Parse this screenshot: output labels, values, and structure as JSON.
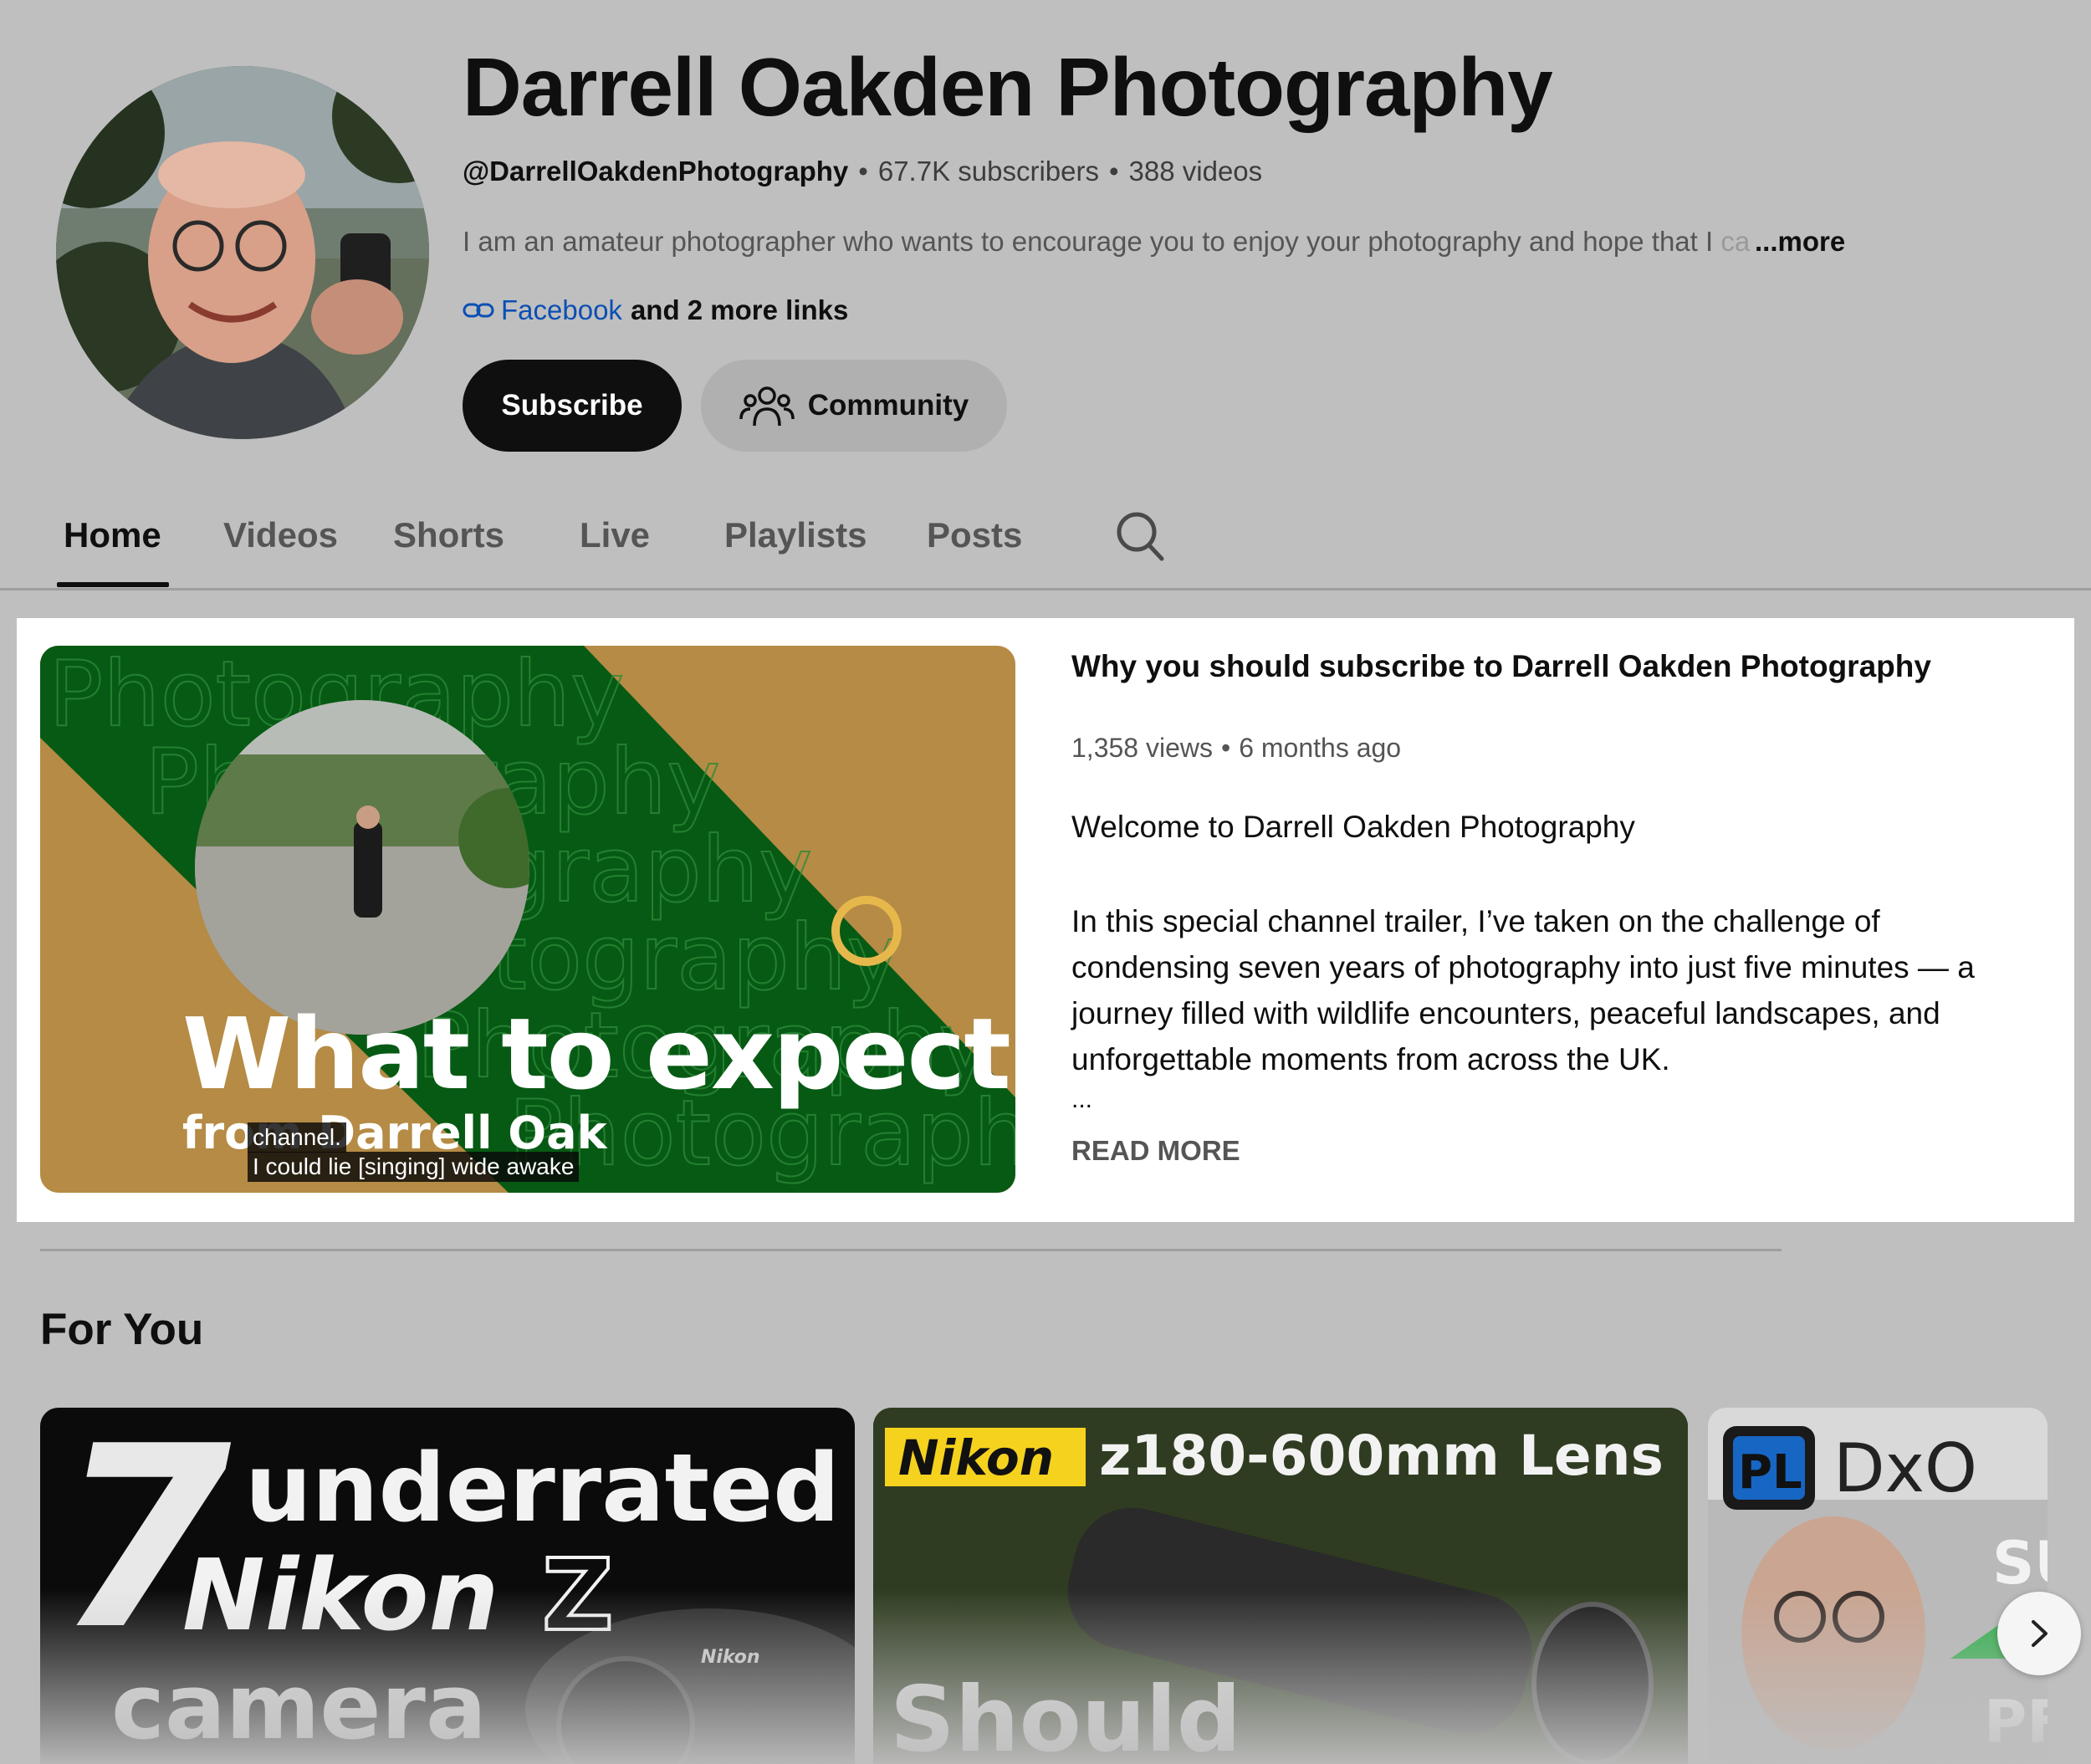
{
  "channel": {
    "title": "Darrell Oakden Photography",
    "handle": "@DarrellOakdenPhotography",
    "subscribers": "67.7K subscribers",
    "videos": "388 videos",
    "separator": "•",
    "description": "I am an amateur photographer who wants to encourage you to enjoy your photography and hope that I ",
    "description_fade": "ca",
    "more_label": "...more",
    "link_primary": "Facebook",
    "link_rest": "and 2 more links"
  },
  "actions": {
    "subscribe_label": "Subscribe",
    "community_label": "Community"
  },
  "tabs": [
    {
      "label": "Home",
      "active": true
    },
    {
      "label": "Videos"
    },
    {
      "label": "Shorts"
    },
    {
      "label": "Live"
    },
    {
      "label": "Playlists"
    },
    {
      "label": "Posts"
    }
  ],
  "featured": {
    "title": "Why you should subscribe to Darrell Oakden Photography",
    "views": "1,358 views",
    "age": "6 months ago",
    "separator": "•",
    "welcome": "Welcome to Darrell Oakden Photography",
    "description": "In this special channel trailer, I’ve taken on the challenge of condensing seven years of photography into just five minutes — a journey filled with wildlife encounters, peaceful landscapes, and unforgettable moments from across the UK.",
    "ellipsis": "...",
    "read_more": "READ MORE",
    "thumbnail": {
      "watermark": "Photography",
      "headline": "What to expect",
      "subline": "from Darrell Oak",
      "caption_1": "channel.",
      "caption_2": "I could lie [singing] wide awake",
      "colors": {
        "green": "#075a14",
        "gold": "#b58b45",
        "ring": "#e6b84c"
      }
    }
  },
  "for_you": {
    "title": "For You",
    "videos": [
      {
        "thumb_text": [
          "7",
          "underrated",
          "Nikon",
          "Z",
          "camera"
        ],
        "badge": "Nikon"
      },
      {
        "thumb_text": [
          "Nikon",
          "z180-600mm Lens",
          "Should"
        ],
        "badge": "Nikon"
      },
      {
        "thumb_text": [
          "PL",
          "DxO",
          "SU",
          "PF"
        ]
      }
    ]
  },
  "icons": {
    "link": "link-icon",
    "community": "people-icon",
    "search": "search-icon",
    "next": "chevron-right-icon"
  }
}
